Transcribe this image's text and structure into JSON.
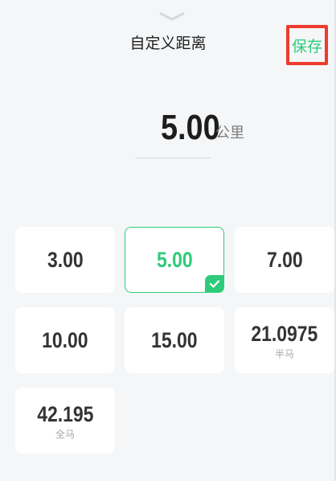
{
  "header": {
    "title": "自定义距离",
    "save_label": "保存"
  },
  "distance": {
    "value": "5.00",
    "unit": "公里"
  },
  "options": [
    {
      "value": "3.00",
      "sub": "",
      "selected": false
    },
    {
      "value": "5.00",
      "sub": "",
      "selected": true
    },
    {
      "value": "7.00",
      "sub": "",
      "selected": false
    },
    {
      "value": "10.00",
      "sub": "",
      "selected": false
    },
    {
      "value": "15.00",
      "sub": "",
      "selected": false
    },
    {
      "value": "21.0975",
      "sub": "半马",
      "selected": false
    },
    {
      "value": "42.195",
      "sub": "全马",
      "selected": false
    }
  ],
  "colors": {
    "accent": "#2ecb7a",
    "highlight_border": "#ee3b2b",
    "background": "#f4f6f8"
  },
  "icons": {
    "handle": "chevron-down-icon",
    "selected_mark": "check-icon"
  }
}
